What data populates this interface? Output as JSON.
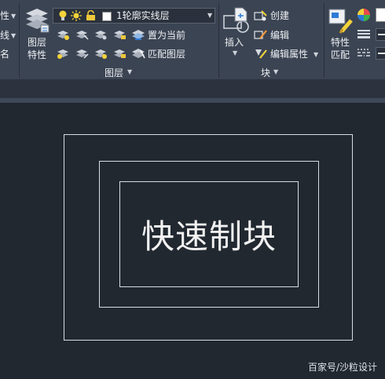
{
  "ribbon": {
    "left_cut": {
      "item1": "性",
      "item2": "线",
      "item3": "名"
    },
    "layers_panel": {
      "properties_btn": {
        "line1": "图层",
        "line2": "特性"
      },
      "current_layer": "1轮廓实线层",
      "set_current_label": "置为当前",
      "match_layer_label": "匹配图层",
      "title": "图层"
    },
    "block_panel": {
      "insert_label": "插入",
      "create_label": "创建",
      "edit_label": "编辑",
      "edit_attr_label": "编辑属性",
      "title": "块"
    },
    "properties_panel": {
      "match_btn": {
        "line1": "特性",
        "line2": "匹配"
      }
    }
  },
  "canvas": {
    "block_text": "快速制块"
  },
  "watermark": "百家号/沙粒设计",
  "colors": {
    "ribbon_bg": "#3b4453",
    "canvas_bg": "#212830",
    "line_color": "#d9dce1",
    "bulb_yellow": "#f3d23a"
  },
  "icons": [
    "layer-properties-icon",
    "bulb-icon",
    "sun-icon",
    "lock-icon",
    "color-swatch-icon",
    "layer-tool-icon",
    "set-current-icon",
    "match-layer-icon",
    "insert-block-icon",
    "create-block-icon",
    "edit-block-icon",
    "edit-attributes-icon",
    "match-properties-icon",
    "color-wheel-icon",
    "lineweight-icon",
    "linetype-icon"
  ]
}
